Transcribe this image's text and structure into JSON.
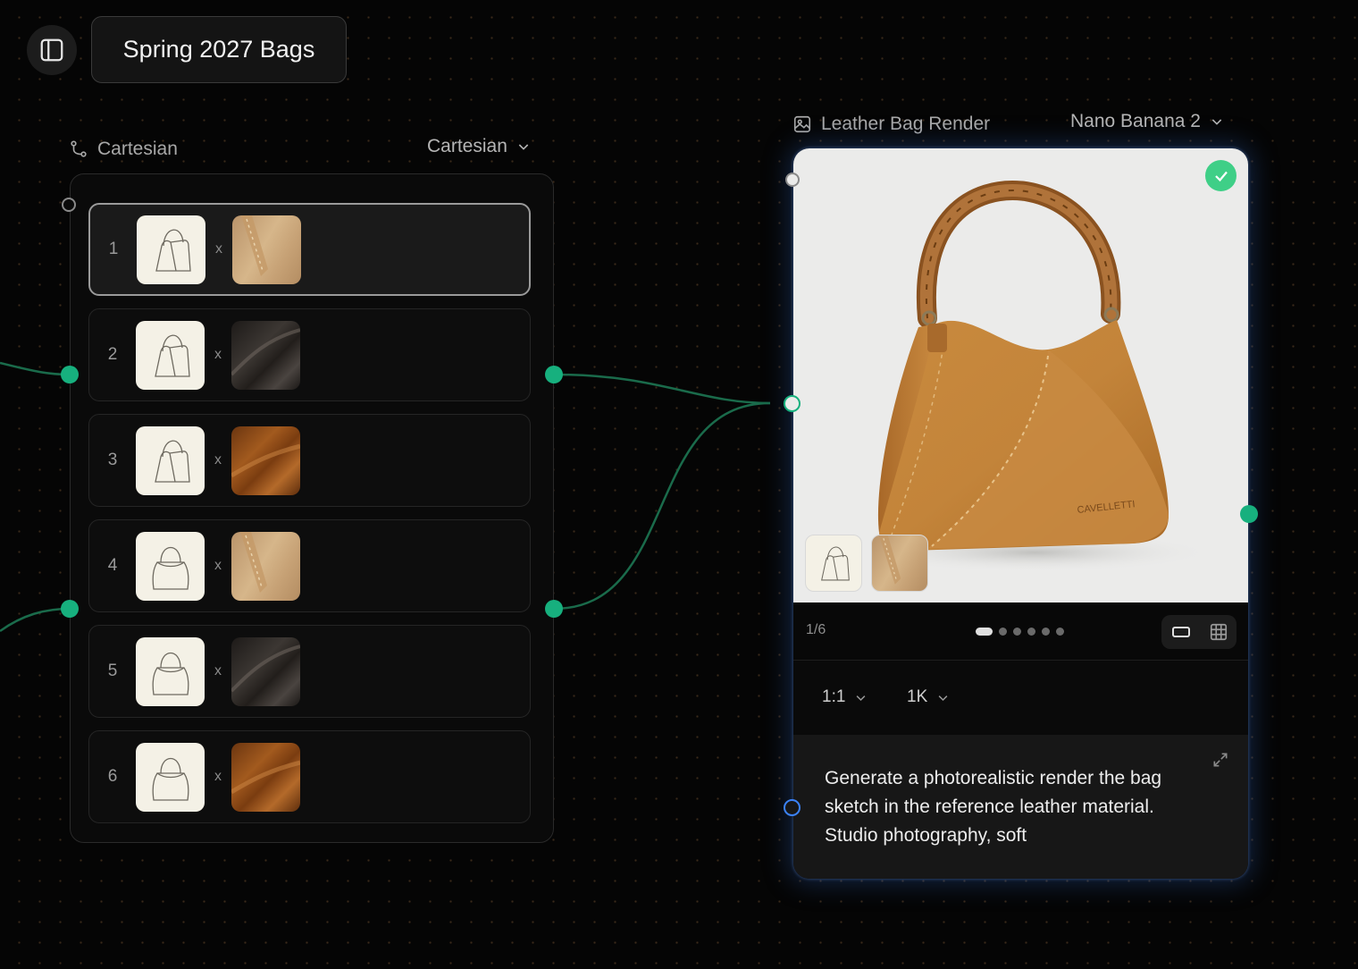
{
  "project": {
    "title": "Spring 2027 Bags"
  },
  "cartesian_node": {
    "label": "Cartesian",
    "mode": "Cartesian",
    "rows": [
      {
        "index": "1",
        "separator": "x",
        "sketch": "shoulder-bag-sketch",
        "material": "tan-suede",
        "selected": true
      },
      {
        "index": "2",
        "separator": "x",
        "sketch": "shoulder-bag-sketch",
        "material": "black-leather",
        "selected": false
      },
      {
        "index": "3",
        "separator": "x",
        "sketch": "shoulder-bag-sketch",
        "material": "brown-leather",
        "selected": false
      },
      {
        "index": "4",
        "separator": "x",
        "sketch": "bucket-bag-sketch",
        "material": "tan-suede",
        "selected": false
      },
      {
        "index": "5",
        "separator": "x",
        "sketch": "bucket-bag-sketch",
        "material": "black-leather",
        "selected": false
      },
      {
        "index": "6",
        "separator": "x",
        "sketch": "bucket-bag-sketch",
        "material": "brown-leather",
        "selected": false
      }
    ]
  },
  "render_node": {
    "label": "Leather Bag Render",
    "model": "Nano Banana 2",
    "image": {
      "subject": "tan suede shoulder bag",
      "brand_text": "CAVELLETTI",
      "status": "complete"
    },
    "reference_thumbs": [
      "shoulder-bag-sketch",
      "tan-suede"
    ],
    "pager": {
      "counter": "1/6",
      "total": 6,
      "current": 1
    },
    "aspect_ratio": "1:1",
    "resolution": "1K",
    "prompt": "Generate a photorealistic render the bag sketch in the reference leather material. Studio photography, soft"
  },
  "colors": {
    "accent_green": "#17b07e",
    "check_green": "#3fcf87",
    "prompt_port_blue": "#3b82f6",
    "background": "#050505"
  }
}
